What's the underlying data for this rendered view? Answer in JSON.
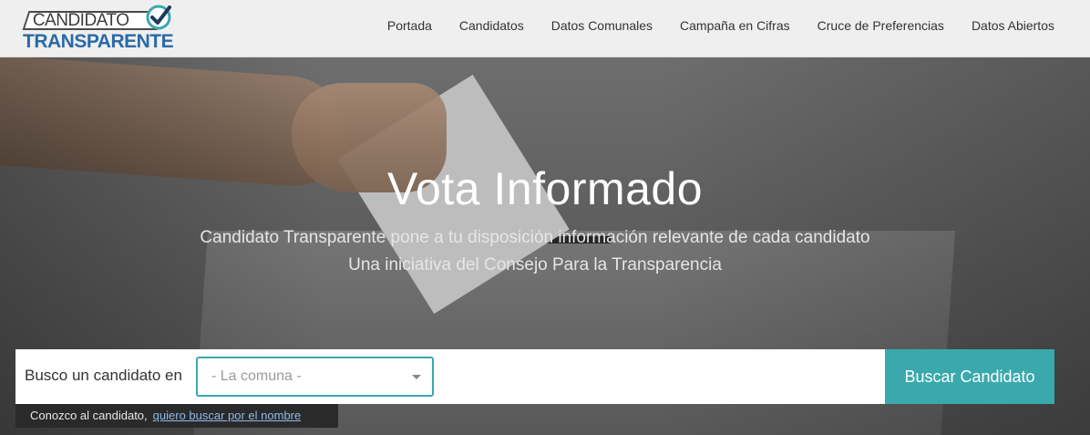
{
  "brand": {
    "logo_line1": "CANDIDATO",
    "logo_line2": "TRANSPARENTE",
    "logo_color": "#2a6aa6",
    "check_color": "#3aa9ae"
  },
  "nav": {
    "items": [
      {
        "label": "Portada"
      },
      {
        "label": "Candidatos"
      },
      {
        "label": "Datos Comunales"
      },
      {
        "label": "Campaña en Cifras"
      },
      {
        "label": "Cruce de Preferencias"
      },
      {
        "label": "Datos Abiertos"
      }
    ]
  },
  "hero": {
    "title": "Vota Informado",
    "subtitle_line1": "Candidato Transparente pone a tu disposición información relevante de cada candidato",
    "subtitle_line2": "Una iniciativa del Consejo Para la Transparencia"
  },
  "search": {
    "label": "Busco un candidato en",
    "select_placeholder": "- La comuna -",
    "button_label": "Buscar Candidato",
    "accent_color": "#3aa9ae"
  },
  "hint": {
    "text": "Conozco al candidato,",
    "link_label": "quiero buscar por el nombre"
  }
}
